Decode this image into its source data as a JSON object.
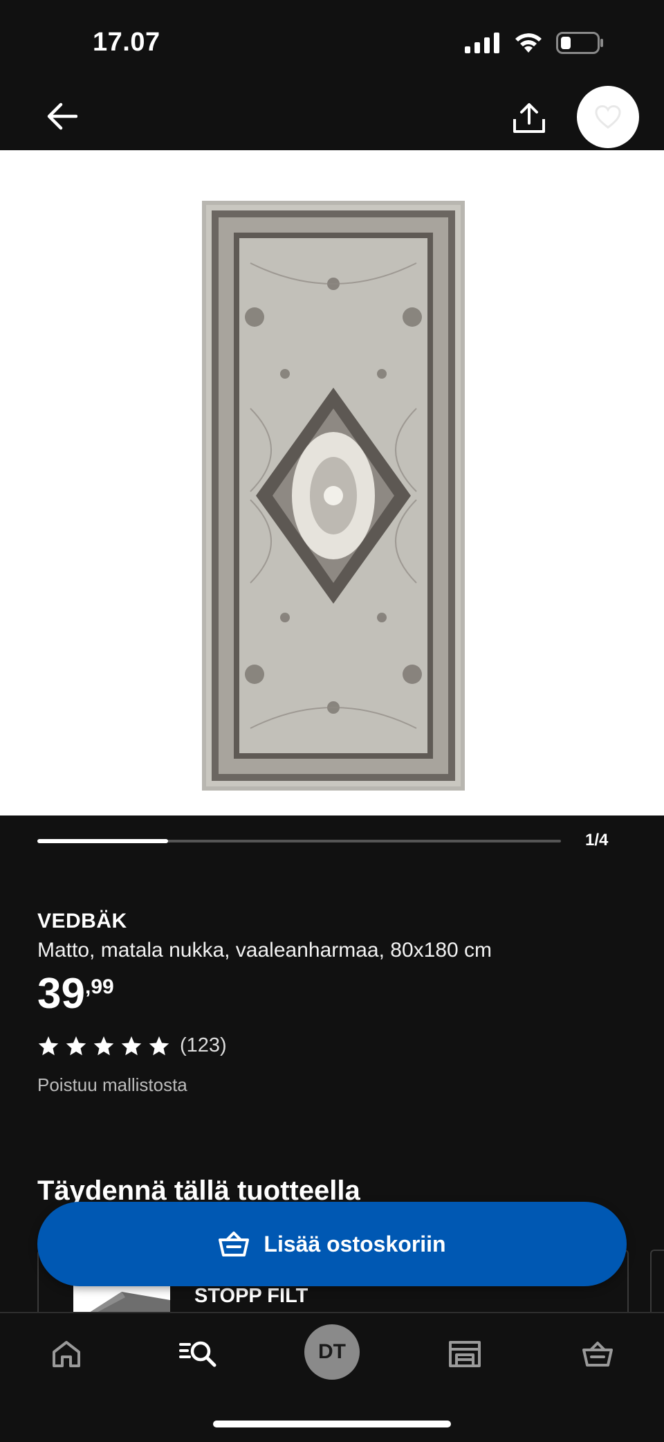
{
  "status_bar": {
    "time": "17.07"
  },
  "product": {
    "brand": "VEDBÄK",
    "description": "Matto, matala nukka, vaaleanharmaa, 80x180 cm",
    "price_integer": "39",
    "price_separator": ",",
    "price_decimal": "99",
    "rating_stars": 5,
    "rating_count": "(123)",
    "notice": "Poistuu mallistosta"
  },
  "carousel": {
    "counter": "1/4",
    "progress": 0.25
  },
  "complement": {
    "title": "Täydennä tällä tuotteella",
    "card_name": "STOPP FILT"
  },
  "cart_button": {
    "label": "Lisää ostoskoriin"
  },
  "bottom_nav": {
    "avatar_initials": "DT"
  },
  "colors": {
    "background": "#111111",
    "accent": "#0058b3",
    "rug": "#c9c7c0"
  }
}
